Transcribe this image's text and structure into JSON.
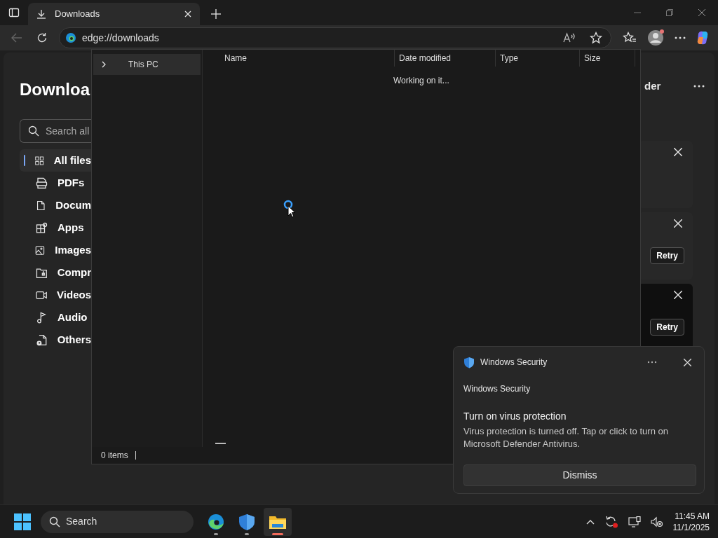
{
  "browser": {
    "tab": {
      "title": "Downloads",
      "selected": true
    },
    "address": "edge://downloads"
  },
  "downloads_page": {
    "title": "Downloa",
    "search_placeholder": "Search all",
    "header_text": "der",
    "nav": [
      {
        "kind": "all",
        "label": "All files",
        "selected": true
      },
      {
        "kind": "pdf",
        "label": "PDFs",
        "selected": false
      },
      {
        "kind": "doc",
        "label": "Docum",
        "selected": false
      },
      {
        "kind": "apps",
        "label": "Apps",
        "selected": false
      },
      {
        "kind": "image",
        "label": "Images",
        "selected": false
      },
      {
        "kind": "zip",
        "label": "Compr",
        "selected": false
      },
      {
        "kind": "video",
        "label": "Videos",
        "selected": false
      },
      {
        "kind": "audio",
        "label": "Audio",
        "selected": false
      },
      {
        "kind": "other",
        "label": "Others",
        "selected": false
      }
    ],
    "cards": [
      {
        "hovered": false
      },
      {
        "retry": "Retry",
        "hovered": false
      },
      {
        "retry": "Retry",
        "hovered": true
      }
    ]
  },
  "dialog": {
    "tree": [
      {
        "label": "This PC",
        "expanded": false,
        "selected": true
      }
    ],
    "columns": [
      "Name",
      "Date modified",
      "Type",
      "Size"
    ],
    "status": "Working on it...",
    "status_bar": "0 items"
  },
  "toast": {
    "app": "Windows Security",
    "source": "Windows Security",
    "title": "Turn on virus protection",
    "body": "Virus protection is turned off. Tap or click to turn on Microsoft Defender Antivirus.",
    "button": "Dismiss"
  },
  "taskbar": {
    "search": "Search",
    "apps": [
      {
        "kind": "edge",
        "active": false
      },
      {
        "kind": "shield",
        "active": false
      },
      {
        "kind": "folder",
        "active": true
      }
    ],
    "time": "11:45 AM",
    "date": "11/1/2025"
  }
}
